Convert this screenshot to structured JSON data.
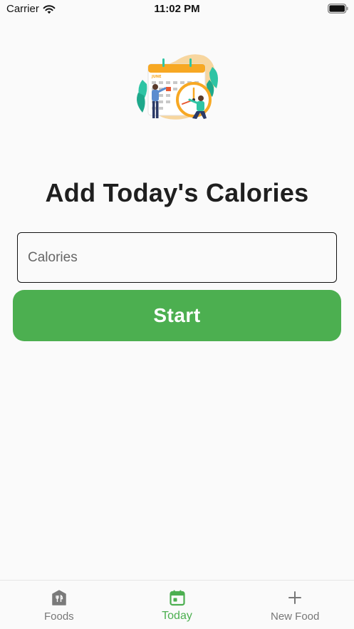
{
  "status_bar": {
    "carrier": "Carrier",
    "time": "11:02 PM",
    "wifi_icon": "wifi-icon",
    "battery_icon": "battery-icon"
  },
  "illustration": {
    "calendar_month": "JUNE",
    "icon": "calendar-clock-illustration"
  },
  "main": {
    "title": "Add Today's Calories",
    "calories_input": {
      "placeholder": "Calories",
      "value": ""
    },
    "start_label": "Start"
  },
  "tabs": [
    {
      "label": "Foods",
      "icon": "food-house-icon",
      "active": false
    },
    {
      "label": "Today",
      "icon": "calendar-icon",
      "active": true
    },
    {
      "label": "New Food",
      "icon": "plus-icon",
      "active": false
    }
  ],
  "colors": {
    "accent": "#4caf50",
    "inactive": "#777777",
    "background": "#fafafa"
  }
}
